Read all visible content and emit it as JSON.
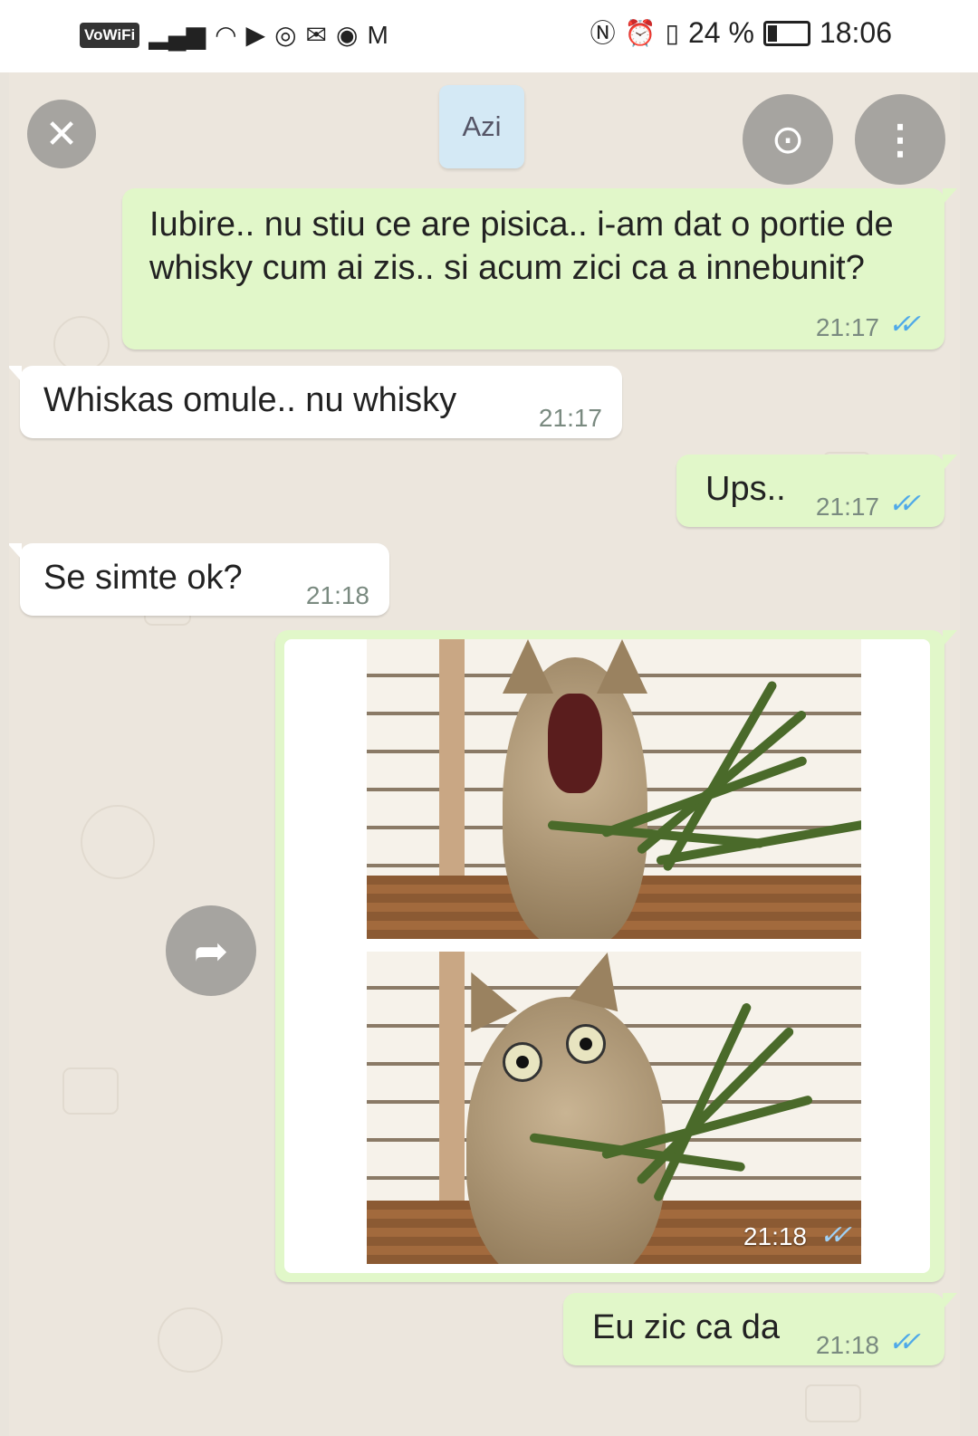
{
  "status_bar": {
    "vowifi": "VoWiFi",
    "battery_text": "24 %",
    "battery_level": 0.24,
    "time": "18:06"
  },
  "chat": {
    "date_label": "Azi",
    "messages": [
      {
        "dir": "out",
        "text": "Iubire.. nu stiu ce are pisica.. i-am dat o portie de whisky cum ai zis.. si acum zici ca a innebunit?",
        "time": "21:17",
        "ticks": "✓✓"
      },
      {
        "dir": "in",
        "text": "Whiskas omule.. nu whisky",
        "time": "21:17"
      },
      {
        "dir": "out",
        "text": "Ups..",
        "time": "21:17",
        "ticks": "✓✓"
      },
      {
        "dir": "in",
        "text": "Se simte ok?",
        "time": "21:18"
      },
      {
        "dir": "out",
        "type": "image",
        "time": "21:18",
        "ticks": "✓✓"
      },
      {
        "dir": "out",
        "text": "Eu zic ca da",
        "time": "21:18",
        "ticks": "✓✓"
      }
    ]
  },
  "viewer": {
    "close_icon": "close-icon",
    "lens_icon": "lens-icon",
    "more_icon": "more-icon",
    "forward_icon": "forward-icon"
  },
  "colors": {
    "outgoing": "#e1f7c9",
    "incoming": "#ffffff",
    "ticks": "#4fa9e8",
    "date_chip": "#d4e9f5"
  }
}
